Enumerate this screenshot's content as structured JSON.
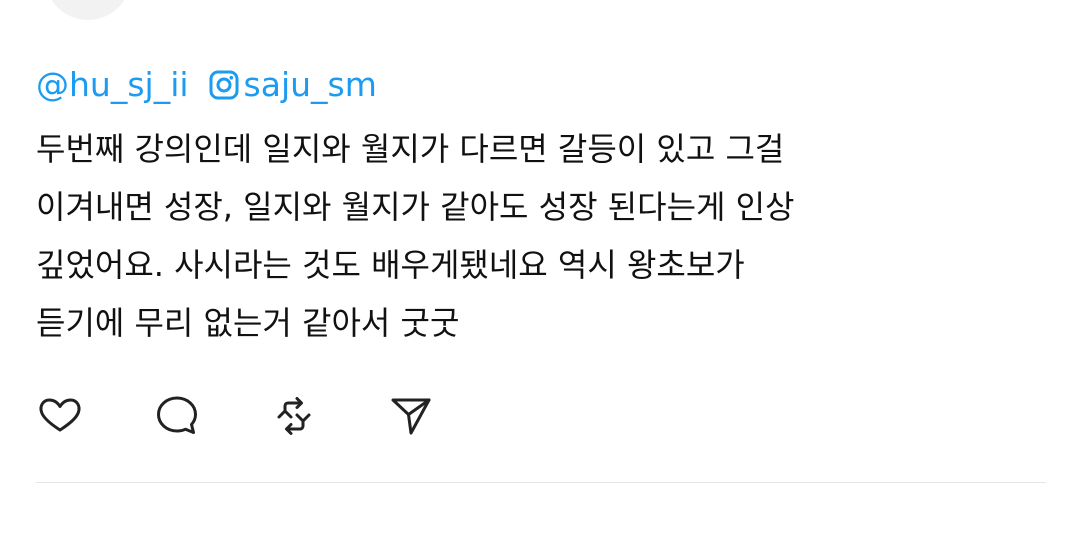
{
  "post": {
    "mentions": {
      "user": "@hu_sj_ii",
      "instagram_handle": "saju_sm",
      "instagram_icon": "instagram-icon",
      "link_color": "#1d9bf0"
    },
    "body_lines": [
      "두번째 강의인데 일지와 월지가 다르면 갈등이 있고 그걸",
      "이겨내면 성장, 일지와 월지가 같아도 성장 된다는게 인상",
      "깊었어요. 사시라는 것도 배우게됐네요 역시 왕초보가",
      "듣기에 무리 없는거 같아서 굿굿"
    ],
    "text_color": "#111111"
  },
  "actions": [
    {
      "name": "like",
      "icon": "heart-icon"
    },
    {
      "name": "reply",
      "icon": "speech-bubble-icon"
    },
    {
      "name": "repost",
      "icon": "repost-icon"
    },
    {
      "name": "share",
      "icon": "send-icon"
    }
  ]
}
